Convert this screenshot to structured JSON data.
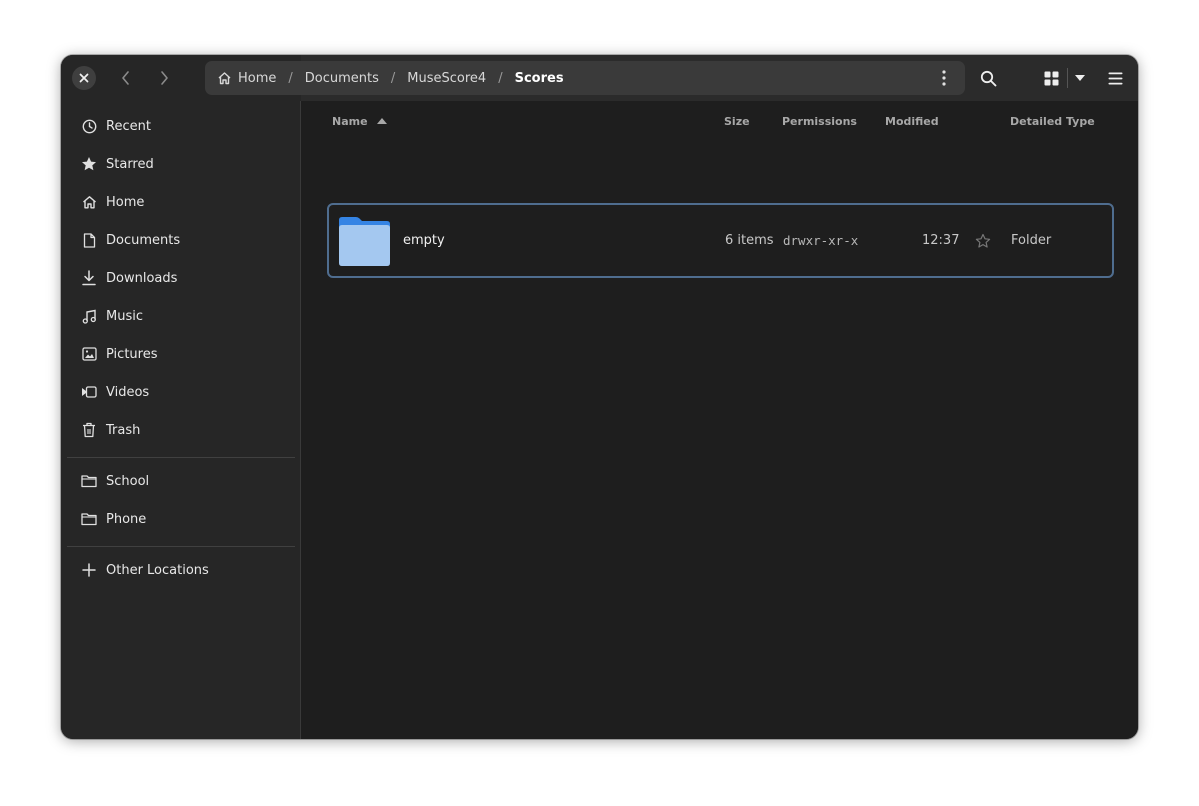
{
  "breadcrumb": [
    {
      "label": "Home"
    },
    {
      "label": "Documents"
    },
    {
      "label": "MuseScore4"
    },
    {
      "label": "Scores"
    }
  ],
  "breadcrumb_separator": "/",
  "sidebar": {
    "items": [
      {
        "label": "Recent",
        "icon": "clock-icon"
      },
      {
        "label": "Starred",
        "icon": "star-icon"
      },
      {
        "label": "Home",
        "icon": "home-icon"
      },
      {
        "label": "Documents",
        "icon": "document-icon"
      },
      {
        "label": "Downloads",
        "icon": "download-icon"
      },
      {
        "label": "Music",
        "icon": "music-note-icon"
      },
      {
        "label": "Pictures",
        "icon": "picture-icon"
      },
      {
        "label": "Videos",
        "icon": "video-icon"
      },
      {
        "label": "Trash",
        "icon": "trash-icon"
      }
    ],
    "bookmarks": [
      {
        "label": "School",
        "icon": "folder-icon"
      },
      {
        "label": "Phone",
        "icon": "folder-icon"
      }
    ],
    "other": {
      "label": "Other Locations",
      "icon": "plus-icon"
    }
  },
  "columns": {
    "name": "Name",
    "size": "Size",
    "permissions": "Permissions",
    "modified": "Modified",
    "type": "Detailed Type"
  },
  "files": [
    {
      "name": "empty",
      "size": "6 items",
      "permissions": "drwxr-xr-x",
      "modified": "12:37",
      "type": "Folder",
      "icon": "folder-icon"
    }
  ],
  "colors": {
    "accent": "#4f6d8f",
    "folder_back": "#3584e4",
    "folder_front": "#a4c8f0"
  }
}
